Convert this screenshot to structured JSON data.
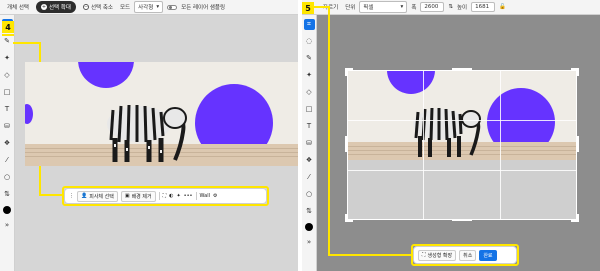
{
  "left": {
    "topbar": {
      "deselect": "개체 선택",
      "expand_selection": "선택 확대",
      "shrink_selection": "선택 축소",
      "mode_label": "모드",
      "mode_value": "사각형",
      "sample_all_layers": "모든 레이어 샘플링"
    },
    "callout_number": "4",
    "taskbar": {
      "select_subject": "피사체 선택",
      "remove_background": "배경 제거",
      "more": "•••",
      "wall": "Wall"
    }
  },
  "right": {
    "callout_number": "5",
    "topbar": {
      "straighten": "자르기",
      "unit_label": "단위",
      "unit_value": "픽셀",
      "width_label": "폭",
      "width_value": "2600",
      "height_label": "높이",
      "height_value": "1681"
    },
    "actionbar": {
      "generative_expand": "생성형 확장",
      "cancel": "취소",
      "done": "완료"
    }
  },
  "colors": {
    "accent_blue": "#1473e6",
    "highlight_yellow": "#ffe600",
    "circle_purple": "#6633ff"
  },
  "icons": {
    "toolbar": [
      "move-icon",
      "select-icon",
      "brush-icon",
      "fill-icon",
      "rectangle-icon",
      "type-icon",
      "stamp-icon",
      "effects-icon",
      "eyedropper-icon",
      "circle-icon",
      "swap-icon",
      "foreground-swatch"
    ]
  }
}
